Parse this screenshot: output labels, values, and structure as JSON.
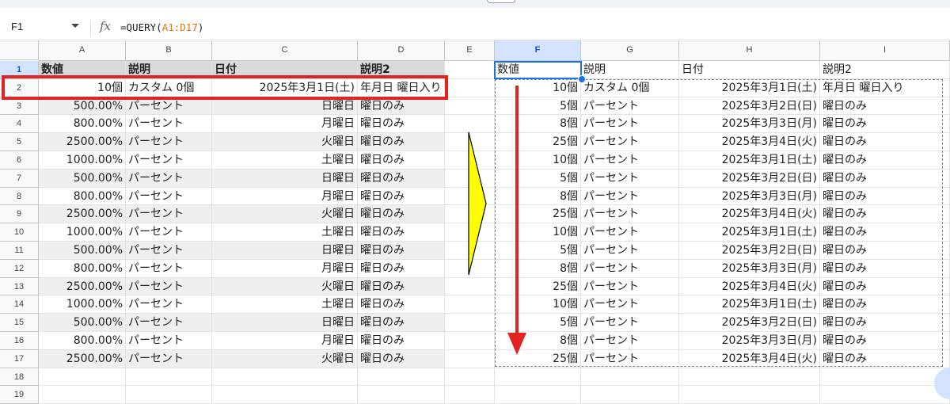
{
  "formula_bar": {
    "name_box": "F1",
    "fx_label": "fx",
    "formula_prefix": "=QUERY(",
    "formula_range": "A1:D17",
    "formula_suffix": ")"
  },
  "columns": [
    "A",
    "B",
    "C",
    "D",
    "E",
    "F",
    "G",
    "H",
    "I"
  ],
  "row_numbers": [
    "1",
    "2",
    "3",
    "4",
    "5",
    "6",
    "7",
    "8",
    "9",
    "10",
    "11",
    "12",
    "13",
    "14",
    "15",
    "16",
    "17",
    "18",
    "19"
  ],
  "left_table": {
    "headers": [
      "数値",
      "説明",
      "日付",
      "説明2"
    ],
    "rows": [
      [
        "10個",
        "カスタム 0個",
        "2025年3月1日(土)",
        "年月日 曜日入り"
      ],
      [
        "500.00%",
        "パーセント",
        "日曜日",
        "曜日のみ"
      ],
      [
        "800.00%",
        "パーセント",
        "月曜日",
        "曜日のみ"
      ],
      [
        "2500.00%",
        "パーセント",
        "火曜日",
        "曜日のみ"
      ],
      [
        "1000.00%",
        "パーセント",
        "土曜日",
        "曜日のみ"
      ],
      [
        "500.00%",
        "パーセント",
        "日曜日",
        "曜日のみ"
      ],
      [
        "800.00%",
        "パーセント",
        "月曜日",
        "曜日のみ"
      ],
      [
        "2500.00%",
        "パーセント",
        "火曜日",
        "曜日のみ"
      ],
      [
        "1000.00%",
        "パーセント",
        "土曜日",
        "曜日のみ"
      ],
      [
        "500.00%",
        "パーセント",
        "日曜日",
        "曜日のみ"
      ],
      [
        "800.00%",
        "パーセント",
        "月曜日",
        "曜日のみ"
      ],
      [
        "2500.00%",
        "パーセント",
        "火曜日",
        "曜日のみ"
      ],
      [
        "1000.00%",
        "パーセント",
        "土曜日",
        "曜日のみ"
      ],
      [
        "500.00%",
        "パーセント",
        "日曜日",
        "曜日のみ"
      ],
      [
        "800.00%",
        "パーセント",
        "月曜日",
        "曜日のみ"
      ],
      [
        "2500.00%",
        "パーセント",
        "火曜日",
        "曜日のみ"
      ]
    ]
  },
  "right_table": {
    "headers": [
      "数値",
      "説明",
      "日付",
      "説明2"
    ],
    "rows": [
      [
        "10個",
        "カスタム 0個",
        "2025年3月1日(土)",
        "年月日 曜日入り"
      ],
      [
        "5個",
        "パーセント",
        "2025年3月2日(日)",
        "曜日のみ"
      ],
      [
        "8個",
        "パーセント",
        "2025年3月3日(月)",
        "曜日のみ"
      ],
      [
        "25個",
        "パーセント",
        "2025年3月4日(火)",
        "曜日のみ"
      ],
      [
        "10個",
        "パーセント",
        "2025年3月1日(土)",
        "曜日のみ"
      ],
      [
        "5個",
        "パーセント",
        "2025年3月2日(日)",
        "曜日のみ"
      ],
      [
        "8個",
        "パーセント",
        "2025年3月3日(月)",
        "曜日のみ"
      ],
      [
        "25個",
        "パーセント",
        "2025年3月4日(火)",
        "曜日のみ"
      ],
      [
        "10個",
        "パーセント",
        "2025年3月1日(土)",
        "曜日のみ"
      ],
      [
        "5個",
        "パーセント",
        "2025年3月2日(日)",
        "曜日のみ"
      ],
      [
        "8個",
        "パーセント",
        "2025年3月3日(月)",
        "曜日のみ"
      ],
      [
        "25個",
        "パーセント",
        "2025年3月4日(火)",
        "曜日のみ"
      ],
      [
        "10個",
        "パーセント",
        "2025年3月1日(土)",
        "曜日のみ"
      ],
      [
        "5個",
        "パーセント",
        "2025年3月2日(日)",
        "曜日のみ"
      ],
      [
        "8個",
        "パーセント",
        "2025年3月3日(月)",
        "曜日のみ"
      ],
      [
        "25個",
        "パーセント",
        "2025年3月4日(火)",
        "曜日のみ"
      ]
    ]
  },
  "selected_cell": "F1",
  "colors": {
    "highlight_border": "#e02424",
    "selection": "#1a73e8",
    "yellow_arrow": "#ffff00",
    "red_arrow": "#e02424",
    "header_shade": "#d9d9d9",
    "row_shade": "#efefef"
  },
  "icons": {
    "name_box_dropdown": "chevron-down-icon",
    "function": "fx-icon",
    "transform_arrow": "yellow-right-arrow-icon",
    "down_arrow": "red-down-arrow-icon"
  }
}
